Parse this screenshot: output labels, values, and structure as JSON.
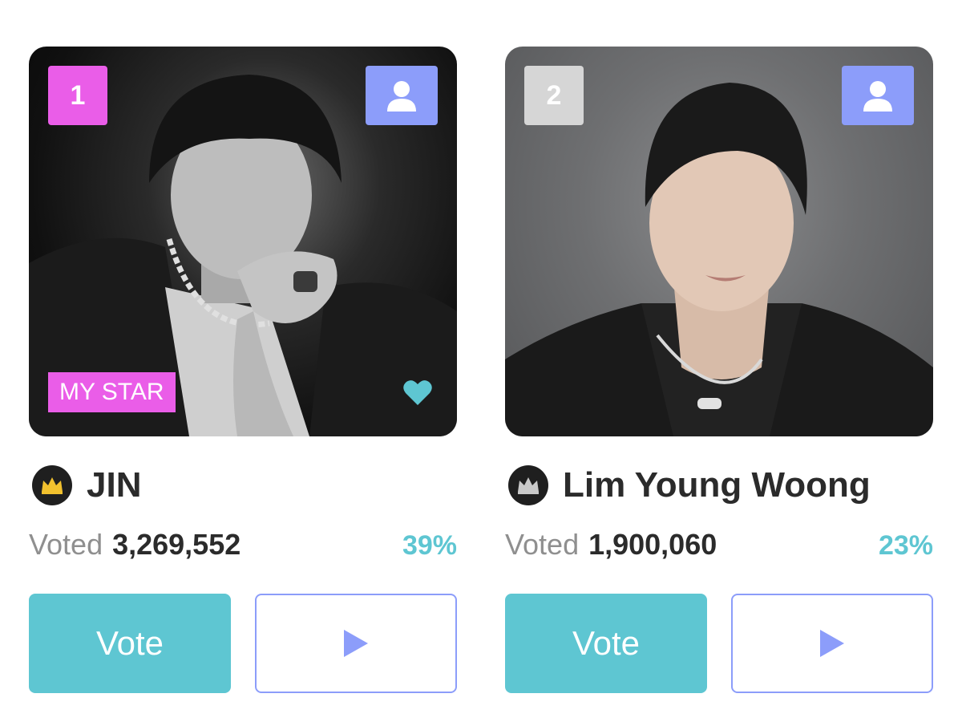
{
  "colors": {
    "rank_first": "#ea5de8",
    "rank_second": "#d6d6d6",
    "accent_teal": "#5ec6d2",
    "accent_periwinkle": "#8c9dfa",
    "crown_gold": "#f2c12e",
    "crown_silver": "#c9c9c9",
    "heart": "#5ec6d2"
  },
  "cards": [
    {
      "rank": "1",
      "badge": "MY STAR",
      "name": "JIN",
      "voted_label": "Voted",
      "votes": "3,269,552",
      "percent": "39%",
      "vote_label": "Vote",
      "crown": "gold-crown-icon",
      "liked": true
    },
    {
      "rank": "2",
      "name": "Lim Young Woong",
      "voted_label": "Voted",
      "votes": "1,900,060",
      "percent": "23%",
      "vote_label": "Vote",
      "crown": "silver-crown-icon"
    }
  ]
}
